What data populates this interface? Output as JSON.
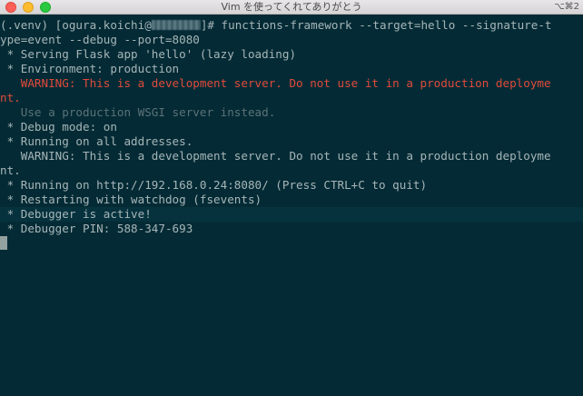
{
  "window": {
    "title": "Vim を使ってくれてありがとう",
    "shortcut": "⌥⌘2"
  },
  "terminal": {
    "prompt_prefix": "(.venv) [ogura.koichi@",
    "prompt_suffix": "]# functions-framework --target=hello --signature-t",
    "command_cont": "ype=event --debug --port=8080",
    "lines": [
      " * Serving Flask app 'hello' (lazy loading)",
      " * Environment: production",
      "   WARNING: This is a development server. Do not use it in a production deployme",
      "nt.",
      "   Use a production WSGI server instead.",
      " * Debug mode: on",
      " * Running on all addresses.",
      "   WARNING: This is a development server. Do not use it in a production deployme",
      "nt.",
      " * Running on http://192.168.0.24:8080/ (Press CTRL+C to quit)",
      " * Restarting with watchdog (fsevents)",
      " * Debugger is active!",
      " * Debugger PIN: 588-347-693"
    ]
  },
  "colors": {
    "background": "#042b35",
    "foreground": "#a6b5b8",
    "warning": "#e14a3c",
    "dim": "#5b7177"
  }
}
